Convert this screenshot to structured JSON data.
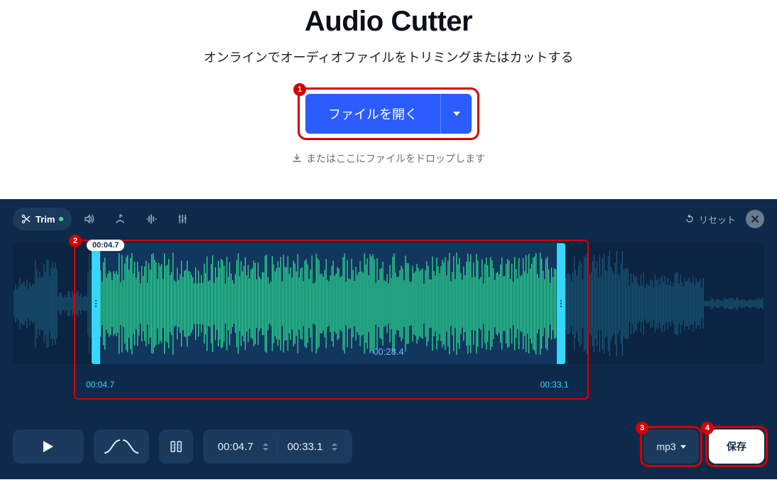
{
  "header": {
    "title": "Audio Cutter",
    "subtitle": "オンラインでオーディオファイルをトリミングまたはカットする"
  },
  "open": {
    "label": "ファイルを開く",
    "drop_hint": "またはここにファイルをドロップします"
  },
  "toolbar": {
    "trim": "Trim",
    "reset": "リセット"
  },
  "wave": {
    "tooltip": "00:04.7",
    "center": "00:28.4",
    "start": "00:04.7",
    "end": "00:33.1"
  },
  "times": {
    "start": "00:04.7",
    "end": "00:33.1"
  },
  "format_label": "mp3",
  "save_label": "保存",
  "badges": {
    "b1": "1",
    "b2": "2",
    "b3": "3",
    "b4": "4"
  }
}
